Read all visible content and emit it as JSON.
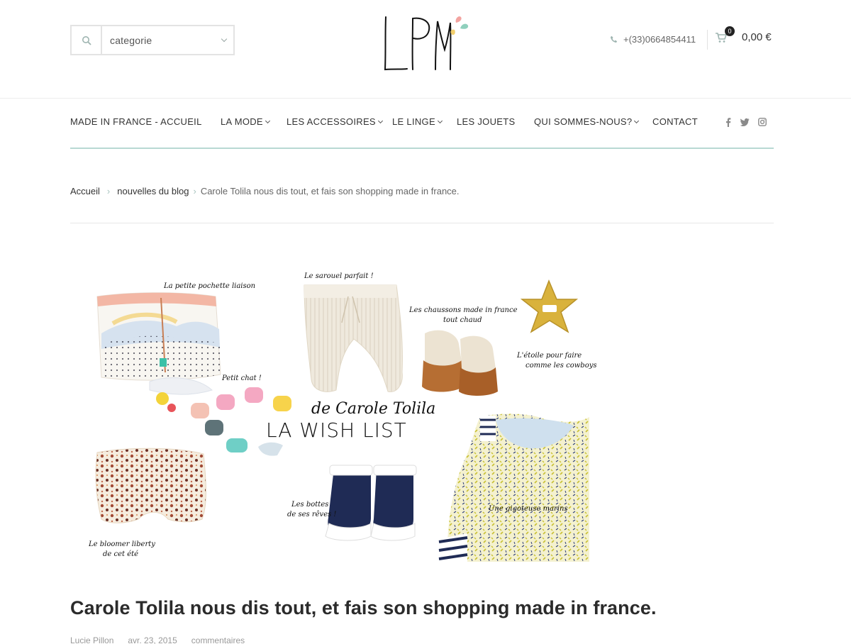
{
  "header": {
    "category_label": "categorie",
    "phone": "+(33)0664854411",
    "cart_count": "0",
    "cart_total": "0,00 €",
    "logo_text": "LPM"
  },
  "nav": {
    "items": [
      {
        "label": "MADE IN FRANCE - ACCUEIL",
        "dropdown": false
      },
      {
        "label": "LA MODE",
        "dropdown": true
      },
      {
        "label": "LES ACCESSOIRES",
        "dropdown": true
      },
      {
        "label": "LE LINGE",
        "dropdown": true
      },
      {
        "label": "LES JOUETS",
        "dropdown": false
      },
      {
        "label": "QUI SOMMES-NOUS?",
        "dropdown": true
      },
      {
        "label": "CONTACT",
        "dropdown": false
      }
    ],
    "social": [
      "facebook-icon",
      "twitter-icon",
      "instagram-icon"
    ]
  },
  "breadcrumb": {
    "home": "Accueil",
    "section": "nouvelles du blog",
    "current": "Carole Tolila nous dis tout, et fais son shopping made in france."
  },
  "hero": {
    "captions": {
      "pochette": "La petite pochette liaison",
      "sarouel": "Le sarouel parfait !",
      "chaussons_1": "Les chaussons made in france",
      "chaussons_2": "tout chaud",
      "etoile_1": "L'étoile pour faire",
      "etoile_2": "comme les cowboys",
      "chat": "Petit chat !",
      "title_1": "de Carole Tolila",
      "title_2": "LA WISH LIST",
      "bottes_1": "Les bottes",
      "bottes_2": "de ses rêves !",
      "gigoteuse": "Une gigoteuse marins",
      "bloomer_1": "Le bloomer liberty",
      "bloomer_2": "de cet été"
    }
  },
  "post": {
    "title": "Carole Tolila nous dis tout, et fais son shopping made in france.",
    "author": "Lucie Pillon",
    "date": "avr. 23, 2015",
    "comments": "commentaires"
  },
  "colors": {
    "accent": "#b8d9d3",
    "logo_pink": "#f3a3a0",
    "logo_green": "#8fd0bd",
    "logo_yellow": "#f2cf6d"
  }
}
